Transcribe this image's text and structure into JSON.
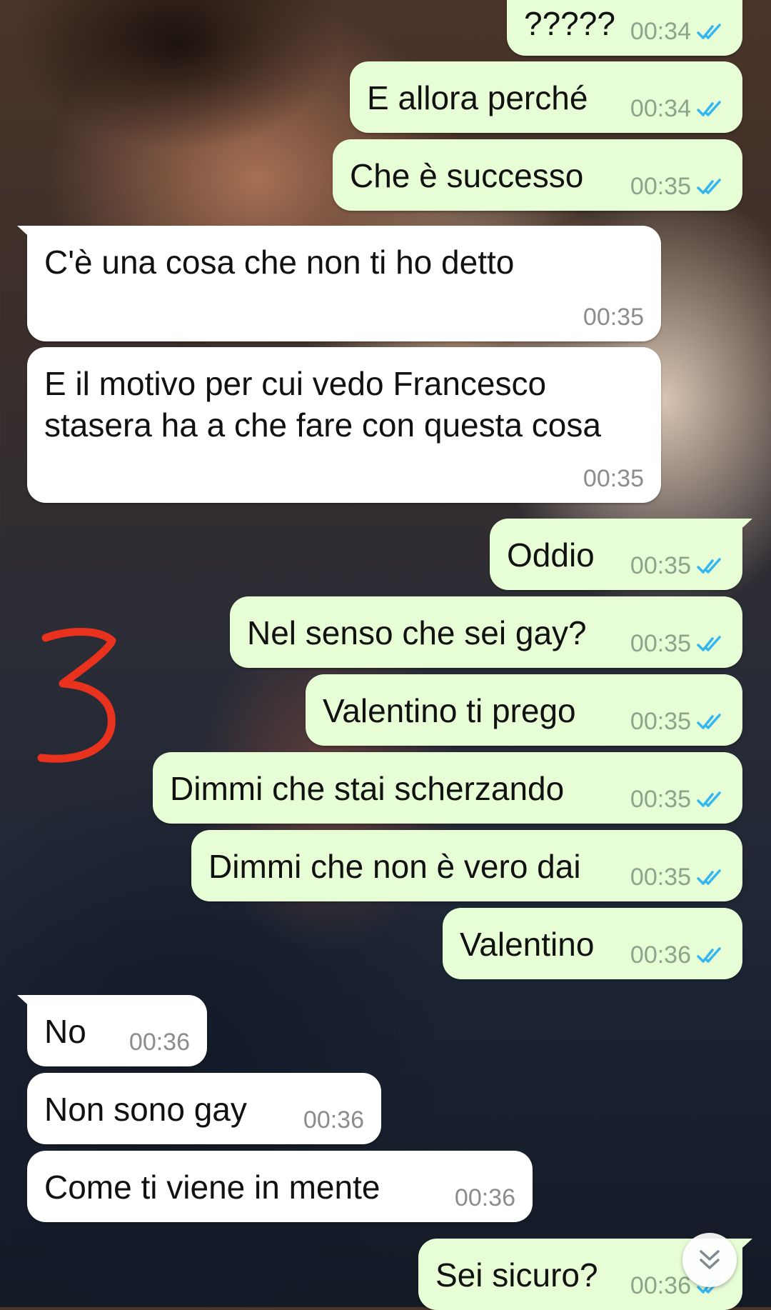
{
  "messages": [
    {
      "direction": "out",
      "text": "?????",
      "time": "00:34",
      "read": true
    },
    {
      "direction": "out",
      "text": "E allora perché",
      "time": "00:34",
      "read": true
    },
    {
      "direction": "out",
      "text": "Che è successo",
      "time": "00:35",
      "read": true
    },
    {
      "direction": "in",
      "text": "C'è una cosa che non ti ho detto",
      "time": "00:35"
    },
    {
      "direction": "in",
      "text": "E il motivo per cui vedo Francesco stasera ha a che fare con questa cosa",
      "time": "00:35"
    },
    {
      "direction": "out",
      "text": "Oddio",
      "time": "00:35",
      "read": true
    },
    {
      "direction": "out",
      "text": "Nel senso che sei gay?",
      "time": "00:35",
      "read": true
    },
    {
      "direction": "out",
      "text": "Valentino ti prego",
      "time": "00:35",
      "read": true
    },
    {
      "direction": "out",
      "text": "Dimmi che stai scherzando",
      "time": "00:35",
      "read": true
    },
    {
      "direction": "out",
      "text": "Dimmi che non è vero dai",
      "time": "00:35",
      "read": true
    },
    {
      "direction": "out",
      "text": "Valentino",
      "time": "00:36",
      "read": true
    },
    {
      "direction": "in",
      "text": "No",
      "time": "00:36"
    },
    {
      "direction": "in",
      "text": "Non sono gay",
      "time": "00:36"
    },
    {
      "direction": "in",
      "text": "Come ti viene in mente",
      "time": "00:36"
    },
    {
      "direction": "out",
      "text": "Sei sicuro?",
      "time": "00:36",
      "read": true
    }
  ],
  "annotation": {
    "text": "3",
    "color": "#e8321e"
  },
  "colors": {
    "outgoing_bubble": "#e7fdd5",
    "incoming_bubble": "#ffffff",
    "read_check": "#34b7f1"
  },
  "icons": {
    "read_receipt": "double-check-icon",
    "scroll": "chevron-double-down-icon"
  }
}
